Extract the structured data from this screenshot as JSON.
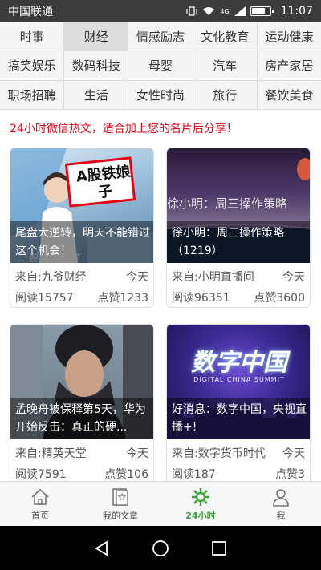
{
  "status": {
    "carrier": "中国联通",
    "network": "4G",
    "time": "11:07"
  },
  "categories": [
    [
      "时事",
      "财经",
      "情感励志",
      "文化教育",
      "运动健康"
    ],
    [
      "搞笑娱乐",
      "数码科技",
      "母婴",
      "汽车",
      "房产家居"
    ],
    [
      "职场招聘",
      "生活",
      "女性时尚",
      "旅行",
      "餐饮美食"
    ]
  ],
  "active_category": "财经",
  "hot_title": "24小时微信热文，适合加上您的名片后分享！",
  "articles": [
    {
      "caption": "尾盘大逆转，明天不能错过这个机会！",
      "source": "来自:九爷财经",
      "when": "今天",
      "reads": "阅读15757",
      "likes": "点赞1233",
      "img_text": "A股铁娘子",
      "img_watermark": "…股评 领心打"
    },
    {
      "caption": "徐小明：周三操作策略（1219）",
      "source": "来自:小明直播间",
      "when": "今天",
      "reads": "阅读96351",
      "likes": "点赞3600",
      "img_text": "徐小明：周三操作策略"
    },
    {
      "caption": "孟晚舟被保释第5天，华为开始反击：真正的硬...",
      "source": "来自:精英天堂",
      "when": "今天",
      "reads": "阅读7591",
      "likes": "点赞106"
    },
    {
      "caption": "好消息：数字中国，央视直播+!",
      "source": "来自:数字货币时代",
      "when": "今天",
      "reads": "阅读187",
      "likes": "点赞3",
      "img_text": "数字中国",
      "img_subtext": "DIGITAL CHINA SUMMIT"
    }
  ],
  "tabs": [
    {
      "label": "首页",
      "icon": "home-icon"
    },
    {
      "label": "我的文章",
      "icon": "articles-icon"
    },
    {
      "label": "24小时",
      "icon": "24h-icon"
    },
    {
      "label": "我",
      "icon": "profile-icon"
    }
  ],
  "active_tab": "24小时",
  "colors": {
    "accent": "#3ba33b",
    "hot_red": "#e60012",
    "statusbar": "#3c3c3c"
  }
}
